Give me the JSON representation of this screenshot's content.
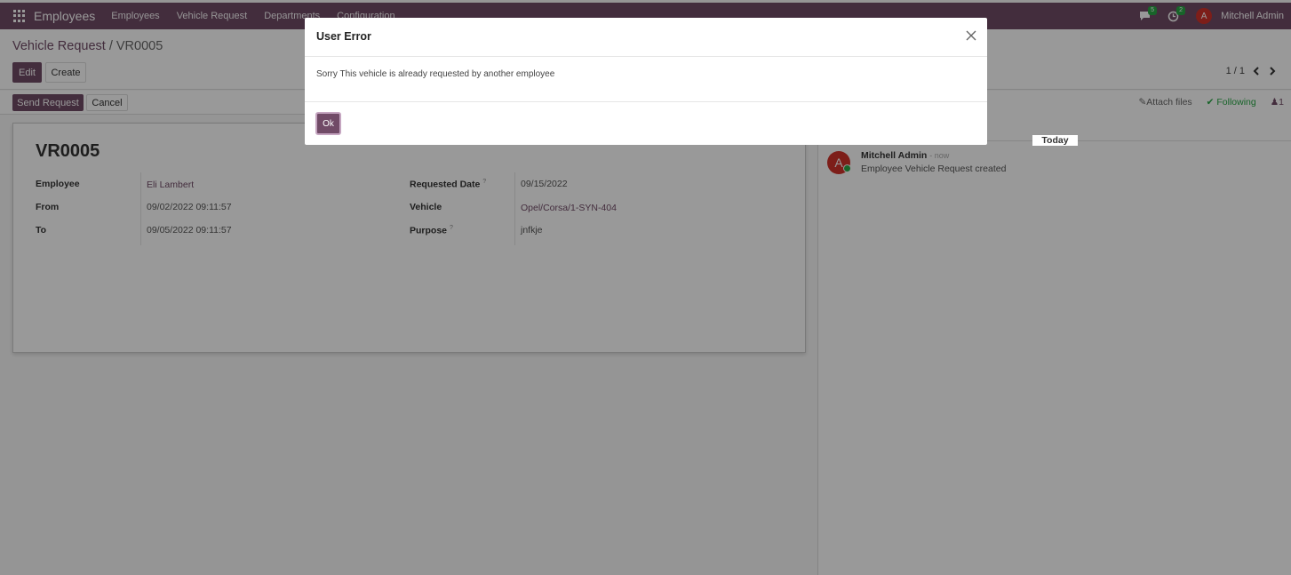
{
  "navbar": {
    "app_name": "Employees",
    "menus": [
      "Employees",
      "Vehicle Request",
      "Departments",
      "Configuration"
    ],
    "messages_badge": "5",
    "activities_badge": "2",
    "user_initial": "A",
    "user_name": "Mitchell Admin"
  },
  "control": {
    "breadcrumb_parent": "Vehicle Request",
    "breadcrumb_separator": "/",
    "breadcrumb_current": "VR0005",
    "edit_label": "Edit",
    "create_label": "Create",
    "pager": "1 / 1"
  },
  "statusbar": {
    "send_request_label": "Send Request",
    "cancel_label": "Cancel"
  },
  "form": {
    "reference": "VR0005",
    "employee_label": "Employee",
    "employee_value": "Eli Lambert",
    "from_label": "From",
    "from_value": "09/02/2022 09:11:57",
    "to_label": "To",
    "to_value": "09/05/2022 09:11:57",
    "requested_date_label": "Requested Date",
    "requested_date_value": "09/15/2022",
    "vehicle_label": "Vehicle",
    "vehicle_value": "Opel/Corsa/1-SYN-404",
    "purpose_label": "Purpose",
    "purpose_value": "jnfkje",
    "help_mark": "?"
  },
  "chatter": {
    "attach_label": "Attach files",
    "following_label": "Following",
    "followers_count": "1",
    "day_label": "Today",
    "message": {
      "avatar_initial": "A",
      "author": "Mitchell Admin",
      "time": "- now",
      "body": "Employee Vehicle Request created"
    }
  },
  "modal": {
    "title": "User Error",
    "body": "Sorry This vehicle is already requested by another employee",
    "ok_label": "Ok"
  },
  "colors": {
    "brand": "#714B67",
    "following": "#28a745",
    "avatar": "#d0322b"
  }
}
